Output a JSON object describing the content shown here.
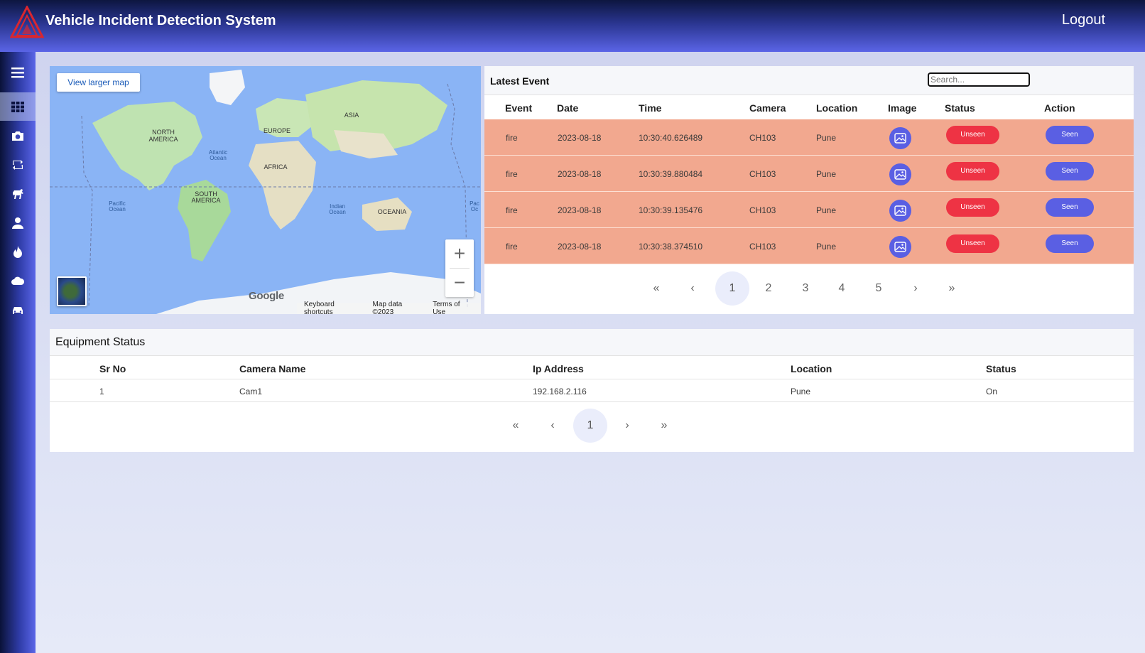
{
  "header": {
    "title": "Vehicle Incident Detection System",
    "logout_label": "Logout"
  },
  "sidebar": {
    "items": [
      {
        "icon": "menu-icon"
      },
      {
        "icon": "dashboard-grid-icon",
        "active": true
      },
      {
        "icon": "camera-icon"
      },
      {
        "icon": "retweet-icon"
      },
      {
        "icon": "horse-icon"
      },
      {
        "icon": "user-icon"
      },
      {
        "icon": "fire-icon"
      },
      {
        "icon": "cloud-icon"
      },
      {
        "icon": "car-icon"
      }
    ]
  },
  "map": {
    "view_larger_label": "View larger map",
    "zoom_in": "+",
    "zoom_out": "−",
    "google_label": "Google",
    "footer": {
      "shortcuts": "Keyboard shortcuts",
      "data": "Map data ©2023",
      "terms": "Terms of Use"
    },
    "labels": {
      "north_america_1": "NORTH",
      "north_america_2": "AMERICA",
      "south_america_1": "SOUTH",
      "south_america_2": "AMERICA",
      "europe": "EUROPE",
      "asia": "ASIA",
      "africa": "AFRICA",
      "oceania": "OCEANIA",
      "atlantic_1": "Atlantic",
      "atlantic_2": "Ocean",
      "pacific_1": "Pacific",
      "pacific_2": "Ocean",
      "indian_1": "Indian",
      "indian_2": "Ocean",
      "pacific_right_1": "Pac",
      "pacific_right_2": "Oc"
    }
  },
  "events": {
    "title": "Latest Event",
    "search_placeholder": "Search...",
    "columns": [
      "Event",
      "Date",
      "Time",
      "Camera",
      "Location",
      "Image",
      "Status",
      "Action"
    ],
    "rows": [
      {
        "event": "fire",
        "date": "2023-08-18",
        "time": "10:30:40.626489",
        "camera": "CH103",
        "location": "Pune",
        "status": "Unseen",
        "action": "Seen"
      },
      {
        "event": "fire",
        "date": "2023-08-18",
        "time": "10:30:39.880484",
        "camera": "CH103",
        "location": "Pune",
        "status": "Unseen",
        "action": "Seen"
      },
      {
        "event": "fire",
        "date": "2023-08-18",
        "time": "10:30:39.135476",
        "camera": "CH103",
        "location": "Pune",
        "status": "Unseen",
        "action": "Seen"
      },
      {
        "event": "fire",
        "date": "2023-08-18",
        "time": "10:30:38.374510",
        "camera": "CH103",
        "location": "Pune",
        "status": "Unseen",
        "action": "Seen"
      }
    ],
    "pagination": {
      "first": "«",
      "prev": "‹",
      "pages": [
        "1",
        "2",
        "3",
        "4",
        "5"
      ],
      "next": "›",
      "last": "»",
      "current": "1"
    }
  },
  "equipment": {
    "title": "Equipment Status",
    "columns": [
      "Sr No",
      "Camera Name",
      "Ip Address",
      "Location",
      "Status"
    ],
    "rows": [
      {
        "sr_no": "1",
        "camera_name": "Cam1",
        "ip_address": "192.168.2.116",
        "location": "Pune",
        "status": "On"
      }
    ],
    "pagination": {
      "first": "«",
      "prev": "‹",
      "pages": [
        "1"
      ],
      "next": "›",
      "last": "»",
      "current": "1"
    }
  }
}
